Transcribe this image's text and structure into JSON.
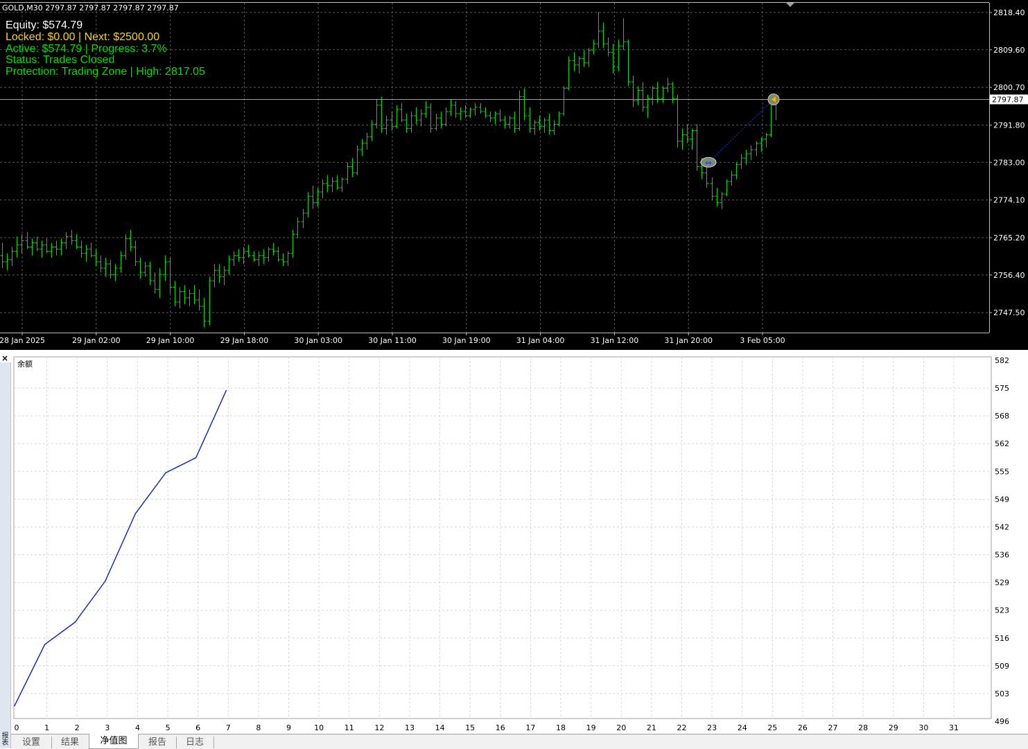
{
  "chart": {
    "symbol": "GOLD,M30",
    "ohlc_readout": "2797.87 2797.87 2797.87 2797.87",
    "current_price_label": "2797.87",
    "price_ticks": [
      "2818.40",
      "2809.60",
      "2800.70",
      "2791.80",
      "2783.00",
      "2774.10",
      "2765.20",
      "2756.40",
      "2747.50"
    ],
    "time_labels": [
      "28 Jan 2025",
      "29 Jan 02:00",
      "29 Jan 10:00",
      "29 Jan 18:00",
      "30 Jan 03:00",
      "30 Jan 11:00",
      "30 Jan 19:00",
      "31 Jan 04:00",
      "31 Jan 12:00",
      "31 Jan 20:00",
      "3 Feb 05:00"
    ],
    "overlay": {
      "equity": "Equity: $574.79",
      "locked": "Locked: $0.00 | Next: $2500.00",
      "active": "Active: $574.79 | Progress: 3.7%",
      "status": "Status: Trades Closed",
      "protection": "Protection: Trading Zone | High: 2817.05"
    },
    "colors": {
      "background": "#000000",
      "bars": "#00e000",
      "grid": "#5a5a5a",
      "text": "#ffffff",
      "locked_text": "#ffd700"
    },
    "price_bars": [
      [
        2761.0,
        2764.0,
        2758.0,
        2759.5
      ],
      [
        2759.5,
        2761.5,
        2757.5,
        2760.0
      ],
      [
        2760.0,
        2763.0,
        2758.5,
        2762.0
      ],
      [
        2762.0,
        2765.5,
        2760.5,
        2763.5
      ],
      [
        2763.5,
        2766.0,
        2761.5,
        2764.5
      ],
      [
        2764.5,
        2766.5,
        2762.5,
        2763.0
      ],
      [
        2763.0,
        2765.0,
        2761.0,
        2764.0
      ],
      [
        2764.0,
        2765.5,
        2762.0,
        2762.5
      ],
      [
        2762.5,
        2764.5,
        2760.5,
        2763.5
      ],
      [
        2763.5,
        2765.0,
        2761.5,
        2762.0
      ],
      [
        2762.0,
        2764.0,
        2760.5,
        2763.0
      ],
      [
        2763.0,
        2764.5,
        2761.0,
        2762.5
      ],
      [
        2762.5,
        2765.0,
        2761.0,
        2764.0
      ],
      [
        2764.0,
        2766.5,
        2762.5,
        2765.5
      ],
      [
        2765.5,
        2767.0,
        2763.5,
        2764.5
      ],
      [
        2764.5,
        2766.0,
        2762.5,
        2763.0
      ],
      [
        2763.0,
        2764.5,
        2760.5,
        2761.5
      ],
      [
        2761.5,
        2763.5,
        2759.5,
        2762.5
      ],
      [
        2762.5,
        2764.0,
        2760.5,
        2761.0
      ],
      [
        2761.0,
        2762.5,
        2758.5,
        2759.5
      ],
      [
        2759.5,
        2761.0,
        2757.0,
        2758.0
      ],
      [
        2758.0,
        2760.5,
        2756.0,
        2759.0
      ],
      [
        2759.0,
        2760.0,
        2755.5,
        2756.5
      ],
      [
        2756.5,
        2759.0,
        2755.0,
        2758.0
      ],
      [
        2758.0,
        2762.0,
        2757.0,
        2761.0
      ],
      [
        2761.0,
        2766.0,
        2760.0,
        2765.0
      ],
      [
        2765.0,
        2767.0,
        2762.0,
        2763.0
      ],
      [
        2763.0,
        2764.5,
        2758.5,
        2759.5
      ],
      [
        2759.5,
        2760.5,
        2755.5,
        2757.0
      ],
      [
        2757.0,
        2759.5,
        2756.0,
        2758.5
      ],
      [
        2758.5,
        2759.5,
        2754.0,
        2755.0
      ],
      [
        2755.0,
        2757.0,
        2752.0,
        2753.0
      ],
      [
        2753.0,
        2758.0,
        2751.0,
        2756.5
      ],
      [
        2756.5,
        2761.0,
        2755.0,
        2759.5
      ],
      [
        2759.5,
        2760.5,
        2752.0,
        2753.5
      ],
      [
        2753.5,
        2755.0,
        2749.0,
        2750.0
      ],
      [
        2750.0,
        2753.5,
        2748.5,
        2752.5
      ],
      [
        2752.5,
        2754.0,
        2749.5,
        2751.0
      ],
      [
        2751.0,
        2753.0,
        2749.0,
        2752.0
      ],
      [
        2752.0,
        2754.0,
        2749.5,
        2750.5
      ],
      [
        2750.5,
        2753.0,
        2748.0,
        2749.0
      ],
      [
        2749.0,
        2751.0,
        2744.0,
        2745.5
      ],
      [
        2745.5,
        2756.0,
        2744.5,
        2755.0
      ],
      [
        2755.0,
        2759.0,
        2753.5,
        2757.5
      ],
      [
        2757.5,
        2759.0,
        2754.5,
        2756.0
      ],
      [
        2756.0,
        2758.5,
        2754.0,
        2757.5
      ],
      [
        2757.5,
        2761.0,
        2756.5,
        2760.0
      ],
      [
        2760.0,
        2762.0,
        2758.5,
        2761.0
      ],
      [
        2761.0,
        2762.5,
        2759.5,
        2760.5
      ],
      [
        2760.5,
        2763.0,
        2759.0,
        2762.0
      ],
      [
        2762.0,
        2763.5,
        2760.5,
        2761.0
      ],
      [
        2761.0,
        2762.0,
        2759.5,
        2760.0
      ],
      [
        2760.0,
        2762.0,
        2758.5,
        2761.0
      ],
      [
        2761.0,
        2762.5,
        2759.0,
        2760.5
      ],
      [
        2760.5,
        2763.0,
        2759.5,
        2762.5
      ],
      [
        2762.5,
        2764.0,
        2761.0,
        2762.0
      ],
      [
        2762.0,
        2763.0,
        2759.5,
        2760.0
      ],
      [
        2760.0,
        2761.5,
        2758.5,
        2759.5
      ],
      [
        2759.5,
        2762.0,
        2758.5,
        2761.5
      ],
      [
        2761.5,
        2767.0,
        2760.5,
        2766.0
      ],
      [
        2766.0,
        2770.0,
        2765.0,
        2769.0
      ],
      [
        2769.0,
        2772.0,
        2767.5,
        2771.0
      ],
      [
        2771.0,
        2776.0,
        2770.0,
        2775.0
      ],
      [
        2775.0,
        2777.5,
        2772.0,
        2773.5
      ],
      [
        2773.5,
        2777.0,
        2772.5,
        2776.0
      ],
      [
        2776.0,
        2779.0,
        2774.5,
        2778.0
      ],
      [
        2778.0,
        2780.0,
        2776.0,
        2777.5
      ],
      [
        2777.5,
        2779.5,
        2776.0,
        2778.5
      ],
      [
        2778.5,
        2780.0,
        2776.5,
        2777.0
      ],
      [
        2777.0,
        2779.5,
        2776.0,
        2779.0
      ],
      [
        2779.0,
        2783.0,
        2778.0,
        2782.0
      ],
      [
        2782.0,
        2784.0,
        2779.5,
        2780.5
      ],
      [
        2780.5,
        2787.0,
        2780.0,
        2786.0
      ],
      [
        2786.0,
        2788.5,
        2784.5,
        2787.5
      ],
      [
        2787.5,
        2790.0,
        2786.0,
        2789.0
      ],
      [
        2789.0,
        2793.0,
        2788.0,
        2792.0
      ],
      [
        2792.0,
        2798.0,
        2791.0,
        2796.5
      ],
      [
        2796.5,
        2798.5,
        2790.0,
        2791.0
      ],
      [
        2791.0,
        2794.0,
        2789.5,
        2793.0
      ],
      [
        2793.0,
        2795.0,
        2790.5,
        2791.5
      ],
      [
        2791.5,
        2796.5,
        2791.0,
        2795.5
      ],
      [
        2795.5,
        2797.0,
        2792.5,
        2793.0
      ],
      [
        2793.0,
        2794.5,
        2790.0,
        2791.0
      ],
      [
        2791.0,
        2795.0,
        2790.0,
        2794.0
      ],
      [
        2794.0,
        2796.0,
        2792.0,
        2793.0
      ],
      [
        2793.0,
        2795.5,
        2791.5,
        2794.5
      ],
      [
        2794.5,
        2797.5,
        2793.5,
        2796.0
      ],
      [
        2796.0,
        2797.0,
        2790.0,
        2791.0
      ],
      [
        2791.0,
        2794.5,
        2790.5,
        2793.5
      ],
      [
        2793.5,
        2795.0,
        2791.0,
        2792.0
      ],
      [
        2792.0,
        2796.0,
        2791.5,
        2795.0
      ],
      [
        2795.0,
        2798.0,
        2794.0,
        2796.5
      ],
      [
        2796.5,
        2797.5,
        2793.5,
        2794.5
      ],
      [
        2794.5,
        2796.0,
        2793.0,
        2795.0
      ],
      [
        2795.0,
        2796.5,
        2793.5,
        2794.0
      ],
      [
        2794.0,
        2796.0,
        2793.5,
        2795.5
      ],
      [
        2795.5,
        2797.0,
        2794.0,
        2796.0
      ],
      [
        2796.0,
        2797.0,
        2794.5,
        2795.0
      ],
      [
        2795.0,
        2796.0,
        2793.5,
        2794.0
      ],
      [
        2794.0,
        2795.0,
        2792.5,
        2793.5
      ],
      [
        2793.5,
        2795.0,
        2792.0,
        2794.5
      ],
      [
        2794.5,
        2795.5,
        2792.5,
        2793.0
      ],
      [
        2793.0,
        2794.0,
        2791.0,
        2792.0
      ],
      [
        2792.0,
        2794.0,
        2791.0,
        2793.5
      ],
      [
        2793.5,
        2795.0,
        2790.0,
        2791.0
      ],
      [
        2791.0,
        2800.0,
        2790.5,
        2798.5
      ],
      [
        2798.5,
        2800.5,
        2793.0,
        2794.0
      ],
      [
        2794.0,
        2796.0,
        2790.0,
        2791.0
      ],
      [
        2791.0,
        2793.0,
        2789.5,
        2792.5
      ],
      [
        2792.5,
        2794.0,
        2790.5,
        2791.5
      ],
      [
        2791.5,
        2793.5,
        2790.0,
        2793.0
      ],
      [
        2793.0,
        2794.5,
        2789.5,
        2790.5
      ],
      [
        2790.5,
        2793.0,
        2789.5,
        2792.0
      ],
      [
        2792.0,
        2795.0,
        2791.5,
        2794.5
      ],
      [
        2794.5,
        2801.0,
        2794.0,
        2800.5
      ],
      [
        2800.5,
        2808.0,
        2800.0,
        2807.0
      ],
      [
        2807.0,
        2809.0,
        2804.5,
        2806.0
      ],
      [
        2806.0,
        2808.0,
        2804.0,
        2807.5
      ],
      [
        2807.5,
        2809.5,
        2805.5,
        2806.5
      ],
      [
        2806.5,
        2810.0,
        2805.5,
        2809.5
      ],
      [
        2809.5,
        2812.0,
        2808.5,
        2811.0
      ],
      [
        2811.0,
        2818.5,
        2810.0,
        2814.0
      ],
      [
        2814.0,
        2816.0,
        2810.0,
        2811.0
      ],
      [
        2811.0,
        2812.5,
        2808.0,
        2809.0
      ],
      [
        2809.0,
        2811.0,
        2804.0,
        2805.5
      ],
      [
        2805.5,
        2812.0,
        2804.5,
        2810.5
      ],
      [
        2810.5,
        2817.0,
        2809.5,
        2811.5
      ],
      [
        2811.5,
        2812.0,
        2801.0,
        2802.0
      ],
      [
        2802.0,
        2803.5,
        2796.0,
        2797.5
      ],
      [
        2797.5,
        2801.0,
        2796.5,
        2800.0
      ],
      [
        2800.0,
        2802.0,
        2795.0,
        2796.0
      ],
      [
        2796.0,
        2799.0,
        2793.5,
        2798.0
      ],
      [
        2798.0,
        2801.0,
        2796.5,
        2800.5
      ],
      [
        2800.5,
        2802.0,
        2797.0,
        2798.0
      ],
      [
        2798.0,
        2801.0,
        2797.0,
        2800.5
      ],
      [
        2800.5,
        2803.0,
        2799.5,
        2801.5
      ],
      [
        2801.5,
        2802.0,
        2797.0,
        2798.0
      ],
      [
        2798.0,
        2799.0,
        2786.5,
        2788.0
      ],
      [
        2788.0,
        2791.0,
        2786.0,
        2789.5
      ],
      [
        2789.5,
        2792.0,
        2787.5,
        2788.5
      ],
      [
        2788.5,
        2791.0,
        2786.0,
        2790.5
      ],
      [
        2790.5,
        2792.0,
        2781.0,
        2782.0
      ],
      [
        2782.0,
        2784.0,
        2779.0,
        2780.5
      ],
      [
        2780.5,
        2782.5,
        2777.0,
        2778.0
      ],
      [
        2778.0,
        2779.5,
        2774.0,
        2775.0
      ],
      [
        2775.0,
        2777.0,
        2772.5,
        2773.5
      ],
      [
        2773.5,
        2776.0,
        2772.0,
        2775.5
      ],
      [
        2775.5,
        2779.0,
        2775.0,
        2778.5
      ],
      [
        2778.5,
        2781.0,
        2777.5,
        2780.0
      ],
      [
        2780.0,
        2783.0,
        2779.0,
        2782.5
      ],
      [
        2782.5,
        2785.0,
        2781.5,
        2784.0
      ],
      [
        2784.0,
        2786.0,
        2782.5,
        2785.0
      ],
      [
        2785.0,
        2787.0,
        2783.5,
        2786.0
      ],
      [
        2786.0,
        2788.0,
        2784.5,
        2787.5
      ],
      [
        2787.5,
        2789.0,
        2785.5,
        2788.5
      ],
      [
        2788.5,
        2790.0,
        2786.5,
        2789.5
      ],
      [
        2789.5,
        2798.5,
        2789.0,
        2797.5
      ],
      [
        2797.5,
        2798.5,
        2793.0,
        2797.87
      ]
    ],
    "trade_open_price": 2783.0,
    "trade_close_price": 2797.87
  },
  "equity_chart": {
    "title": "余额",
    "close_symbol": "×",
    "side_label": "报表",
    "x_ticks": [
      "0",
      "1",
      "2",
      "3",
      "4",
      "5",
      "6",
      "7",
      "8",
      "9",
      "10",
      "11",
      "12",
      "13",
      "14",
      "15",
      "16",
      "17",
      "18",
      "19",
      "20",
      "21",
      "22",
      "23",
      "24",
      "25",
      "26",
      "27",
      "28",
      "29",
      "30",
      "31"
    ],
    "y_ticks": [
      "582",
      "575",
      "568",
      "562",
      "555",
      "549",
      "542",
      "536",
      "529",
      "523",
      "516",
      "509",
      "503",
      "496"
    ],
    "line_color": "#1c2bb8"
  },
  "chart_data": {
    "type": "line",
    "title": "余额",
    "xlabel": "",
    "ylabel": "",
    "x": [
      0,
      1,
      2,
      3,
      4,
      5,
      6,
      7
    ],
    "series": [
      {
        "values": [
          499.7,
          514.3,
          519.6,
          529.4,
          545.5,
          555.2,
          558.8,
          574.79
        ]
      }
    ],
    "xlim": [
      0,
      31
    ],
    "ylim": [
      496,
      582
    ],
    "grid": true
  },
  "tabs": [
    {
      "label": "设置",
      "active": false
    },
    {
      "label": "结果",
      "active": false
    },
    {
      "label": "净值图",
      "active": true
    },
    {
      "label": "报告",
      "active": false
    },
    {
      "label": "日志",
      "active": false
    }
  ]
}
